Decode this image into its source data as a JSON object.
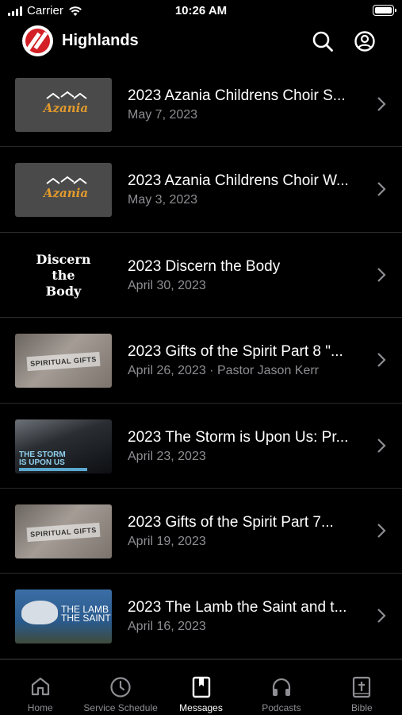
{
  "status_bar": {
    "carrier": "Carrier",
    "time": "10:26 AM"
  },
  "header": {
    "title": "Highlands"
  },
  "messages": [
    {
      "title": "2023 Azania Childrens Choir S...",
      "subtitle": "May 7, 2023",
      "thumbnail": "azania",
      "thumb_text": "Azania"
    },
    {
      "title": "2023 Azania Childrens Choir W...",
      "subtitle": "May 3, 2023",
      "thumbnail": "azania",
      "thumb_text": "Azania"
    },
    {
      "title": "2023 Discern the Body",
      "subtitle": "April 30, 2023",
      "thumbnail": "discern",
      "thumb_text": [
        "Discern",
        "the",
        "Body"
      ]
    },
    {
      "title": "2023 Gifts of the Spirit Part 8 \"...",
      "subtitle": "April 26, 2023 · Pastor Jason Kerr",
      "thumbnail": "spiritual",
      "thumb_text": "SPIRITUAL GIFTS"
    },
    {
      "title": "2023 The Storm is Upon Us: Pr...",
      "subtitle": "April 23, 2023",
      "thumbnail": "storm",
      "thumb_text": [
        "THE STORM",
        "IS UPON US"
      ]
    },
    {
      "title": "2023 Gifts of the Spirit Part 7...",
      "subtitle": "April 19, 2023",
      "thumbnail": "spiritual",
      "thumb_text": "SPIRITUAL GIFTS"
    },
    {
      "title": "2023 The Lamb the Saint and t...",
      "subtitle": "April 16, 2023",
      "thumbnail": "lamb",
      "thumb_text": [
        "THE LAMB",
        "THE SAINT"
      ]
    }
  ],
  "tabs": [
    {
      "label": "Home",
      "icon": "home-icon",
      "active": false
    },
    {
      "label": "Service Schedule",
      "icon": "clock-icon",
      "active": false
    },
    {
      "label": "Messages",
      "icon": "bookmark-book-icon",
      "active": true
    },
    {
      "label": "Podcasts",
      "icon": "headphones-icon",
      "active": false
    },
    {
      "label": "Bible",
      "icon": "bible-icon",
      "active": false
    }
  ],
  "colors": {
    "background": "#000000",
    "text": "#ffffff",
    "subtext": "#8e8e93",
    "logo_red": "#d32027"
  }
}
